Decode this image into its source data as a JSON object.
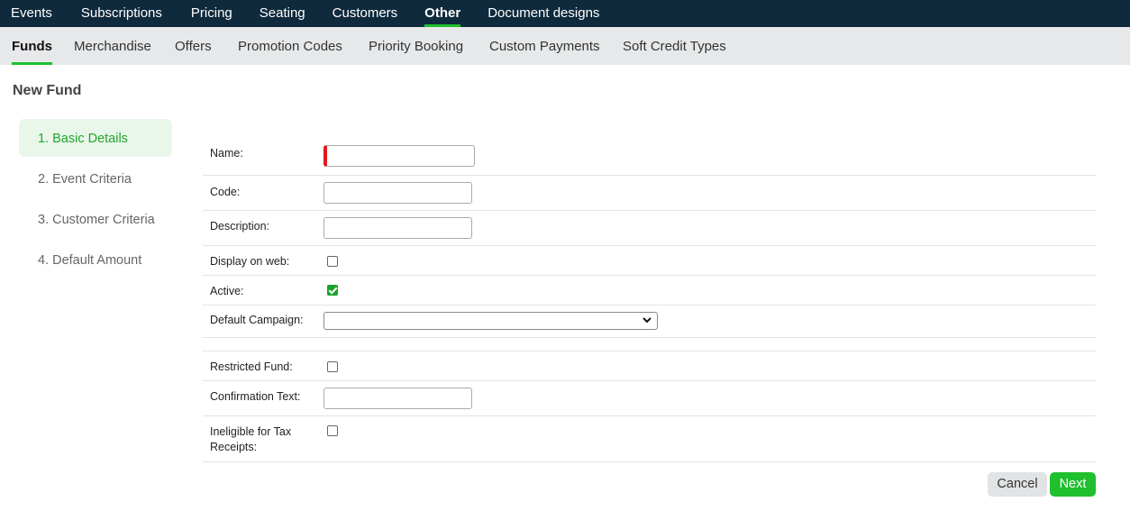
{
  "top_nav": {
    "items": [
      {
        "label": "Events"
      },
      {
        "label": "Subscriptions"
      },
      {
        "label": "Pricing"
      },
      {
        "label": "Seating"
      },
      {
        "label": "Customers"
      },
      {
        "label": "Other"
      },
      {
        "label": "Document designs"
      }
    ],
    "active": "Other"
  },
  "sub_nav": {
    "items": [
      {
        "label": "Funds"
      },
      {
        "label": "Merchandise"
      },
      {
        "label": "Offers"
      },
      {
        "label": "Promotion Codes"
      },
      {
        "label": "Priority Booking"
      },
      {
        "label": "Custom Payments"
      },
      {
        "label": "Soft Credit Types"
      }
    ],
    "active": "Funds"
  },
  "page": {
    "title": "New Fund"
  },
  "steps": [
    {
      "label": "1. Basic Details",
      "active": true
    },
    {
      "label": "2. Event Criteria",
      "active": false
    },
    {
      "label": "3. Customer Criteria",
      "active": false
    },
    {
      "label": "4. Default Amount",
      "active": false
    }
  ],
  "form": {
    "name": {
      "label": "Name:",
      "value": "",
      "required": true
    },
    "code": {
      "label": "Code:",
      "value": ""
    },
    "description": {
      "label": "Description:",
      "value": ""
    },
    "display_on_web": {
      "label": "Display on web:",
      "checked": false
    },
    "active": {
      "label": "Active:",
      "checked": true
    },
    "default_campaign": {
      "label": "Default Campaign:",
      "selected": ""
    },
    "restricted_fund": {
      "label": "Restricted Fund:",
      "checked": false
    },
    "confirmation_text": {
      "label": "Confirmation Text:",
      "value": ""
    },
    "ineligible_tax": {
      "label": "Ineligible for Tax Receipts:",
      "checked": false
    }
  },
  "buttons": {
    "cancel": "Cancel",
    "next": "Next"
  },
  "colors": {
    "nav_bg": "#0f2a3d",
    "accent": "#1fbf2e",
    "subnav_bg": "#e6e8ea",
    "required": "#e01b1b"
  }
}
